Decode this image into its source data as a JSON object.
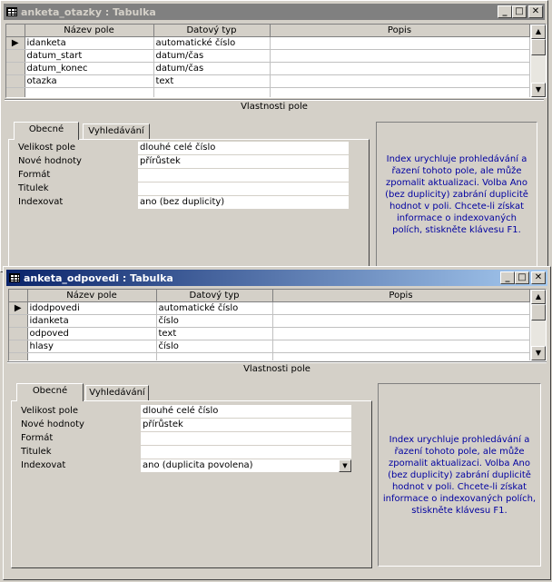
{
  "window1": {
    "title": "anketa_otazky : Tabulka",
    "columns": [
      "Název pole",
      "Datový typ",
      "Popis"
    ],
    "rows": [
      {
        "name": "idanketa",
        "type": "automatické číslo",
        "desc": ""
      },
      {
        "name": "datum_start",
        "type": "datum/čas",
        "desc": ""
      },
      {
        "name": "datum_konec",
        "type": "datum/čas",
        "desc": ""
      },
      {
        "name": "otazka",
        "type": "text",
        "desc": ""
      },
      {
        "name": "",
        "type": "",
        "desc": ""
      }
    ],
    "section_label": "Vlastnosti pole",
    "tabs": [
      "Obecné",
      "Vyhledávání"
    ],
    "properties": [
      {
        "label": "Velikost pole",
        "value": "dlouhé celé číslo"
      },
      {
        "label": "Nové hodnoty",
        "value": "přírůstek"
      },
      {
        "label": "Formát",
        "value": ""
      },
      {
        "label": "Titulek",
        "value": ""
      },
      {
        "label": "Indexovat",
        "value": "ano (bez duplicity)"
      }
    ],
    "hint": "Index urychluje prohledávání a řazení tohoto pole, ale může zpomalit aktualizaci. Volba Ano (bez duplicity) zabrání duplicitě hodnot v poli. Chcete-li získat informace o indexovaných polích, stiskněte klávesu F1."
  },
  "window2": {
    "title": "anketa_odpovedi : Tabulka",
    "columns": [
      "Název pole",
      "Datový typ",
      "Popis"
    ],
    "rows": [
      {
        "name": "idodpovedi",
        "type": "automatické číslo",
        "desc": ""
      },
      {
        "name": "idanketa",
        "type": "číslo",
        "desc": ""
      },
      {
        "name": "odpoved",
        "type": "text",
        "desc": ""
      },
      {
        "name": "hlasy",
        "type": "číslo",
        "desc": ""
      },
      {
        "name": "",
        "type": "",
        "desc": ""
      }
    ],
    "section_label": "Vlastnosti pole",
    "tabs": [
      "Obecné",
      "Vyhledávání"
    ],
    "properties": [
      {
        "label": "Velikost pole",
        "value": "dlouhé celé číslo"
      },
      {
        "label": "Nové hodnoty",
        "value": "přírůstek"
      },
      {
        "label": "Formát",
        "value": ""
      },
      {
        "label": "Titulek",
        "value": ""
      },
      {
        "label": "Indexovat",
        "value": "ano (duplicita povolena)"
      }
    ],
    "hint": "Index urychluje prohledávání a řazení tohoto pole, ale může zpomalit aktualizaci. Volba Ano (bez duplicity) zabrání duplicitě hodnot v poli. Chcete-li získat informace o indexovaných polích, stiskněte klávesu F1."
  },
  "icons": {
    "minimize": "minimize-icon",
    "maximize": "maximize-icon",
    "close": "close-icon",
    "row_selector": "row-pointer-icon",
    "dropdown": "chevron-down-icon"
  },
  "colors": {
    "active_title_start": "#0a246a",
    "active_title_end": "#a6caf0",
    "inactive_title": "#808080",
    "hint_text": "#0000a0",
    "face": "#d4d0c8"
  }
}
